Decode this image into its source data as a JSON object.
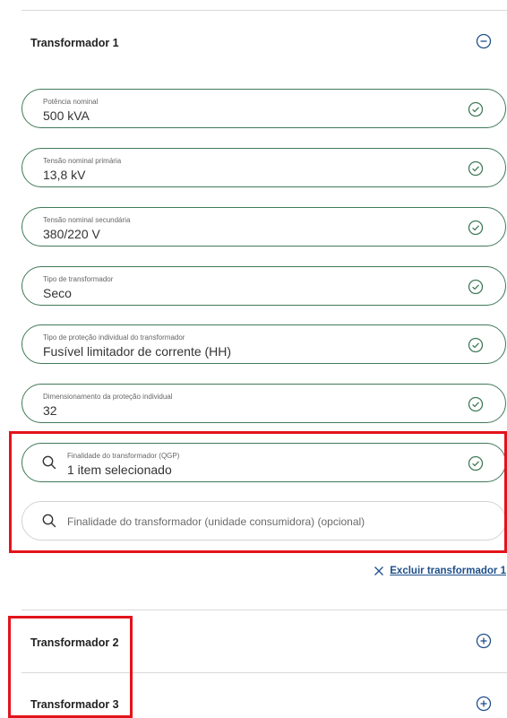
{
  "transformer1": {
    "title": "Transformador 1",
    "toggle_icon": "minus-circle-icon",
    "fields": [
      {
        "label": "Potência nominal",
        "value": "500 kVA"
      },
      {
        "label": "Tensão nominal primária",
        "value": "13,8 kV"
      },
      {
        "label": "Tensão nominal secundária",
        "value": "380/220 V"
      },
      {
        "label": "Tipo de transformador",
        "value": "Seco"
      },
      {
        "label": "Tipo de proteção individual do transformador",
        "value": "Fusível limitador de corrente (HH)"
      },
      {
        "label": "Dimensionamento da proteção individual",
        "value": "32"
      }
    ],
    "qgp_field": {
      "label": "Finalidade do transformador (QGP)",
      "value": "1 item selecionado"
    },
    "consumer_unit_field": {
      "placeholder": "Finalidade do transformador (unidade consumidora) (opcional)"
    },
    "delete_label": "Excluir transformador 1"
  },
  "transformer2": {
    "title": "Transformador 2",
    "toggle_icon": "plus-circle-icon"
  },
  "transformer3": {
    "title": "Transformador 3",
    "toggle_icon": "plus-circle-icon"
  },
  "colors": {
    "accent_green": "#3f7a58",
    "link_blue": "#1f4f8a",
    "highlight_red": "#e3131b"
  }
}
